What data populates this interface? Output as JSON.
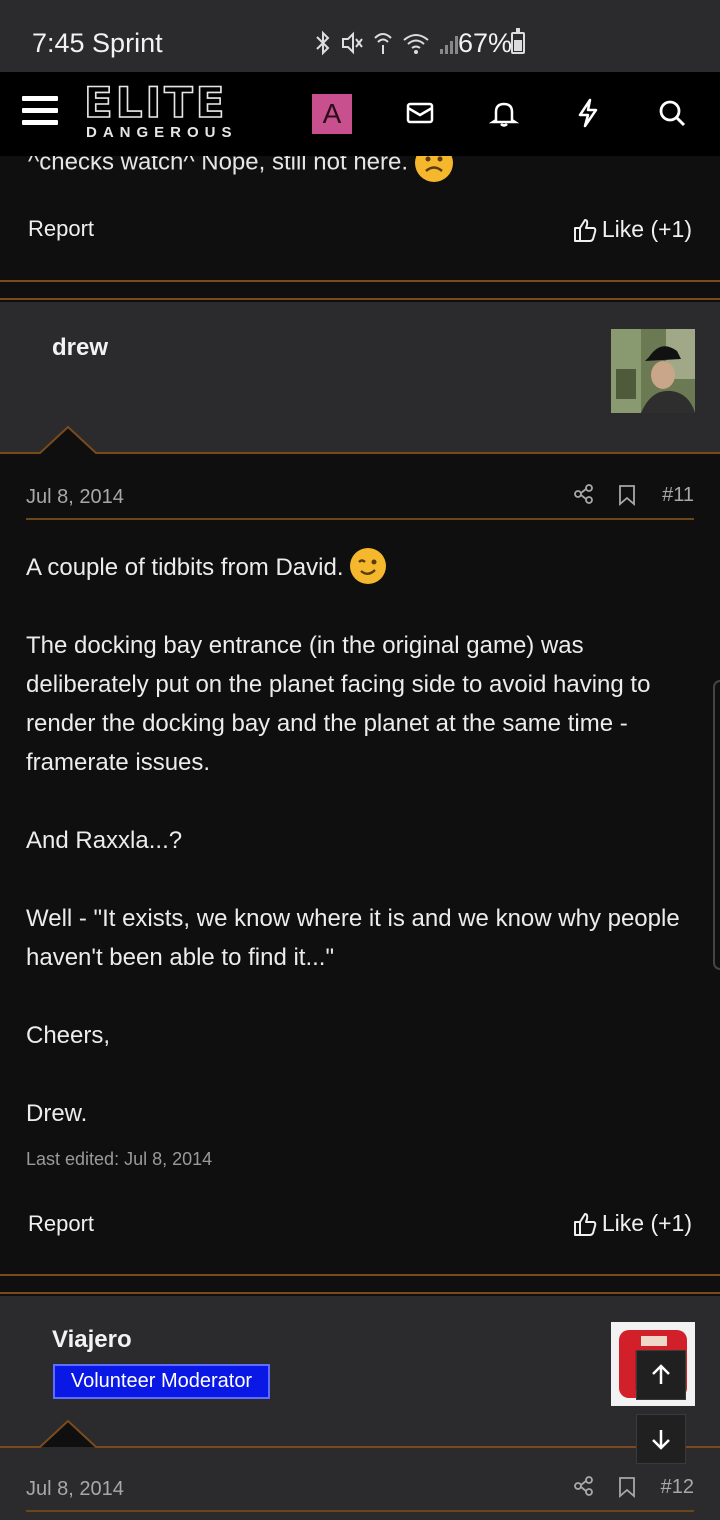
{
  "status_bar": {
    "time_carrier": "7:45 Sprint",
    "battery": "67%",
    "battery_level": 0.67
  },
  "header": {
    "logo_main": "ELITE",
    "logo_sub": "DANGEROUS",
    "avatar_letter": "A",
    "icons": [
      "menu-icon",
      "mail-icon",
      "bell-icon",
      "lightning-icon",
      "search-icon"
    ]
  },
  "previous_post": {
    "tail_text": "^checks watch^ Nope, still not here.",
    "report_label": "Report",
    "like_label": "Like (+1)"
  },
  "post_11": {
    "username": "drew",
    "date": "Jul 8, 2014",
    "number": "#11",
    "paragraphs": [
      "A couple of tidbits from David.",
      "The docking bay entrance (in the original game) was deliberately put on the planet facing side to avoid having to render the docking bay and the planet at the same time - framerate issues.",
      "And Raxxla...?",
      "Well - \"It exists, we know where it is and we know why people haven't been able to find it...\"",
      "Cheers,",
      "Drew."
    ],
    "last_edited": "Last edited: Jul 8, 2014",
    "report_label": "Report",
    "like_label": "Like (+1)"
  },
  "post_12": {
    "username": "Viajero",
    "badge": "Volunteer Moderator",
    "date": "Jul 8, 2014",
    "number": "#12"
  },
  "colors": {
    "accent_border": "#7a4a1c",
    "moderator_badge": "#0a18e6",
    "avatar_a_bg": "#c9508e"
  }
}
